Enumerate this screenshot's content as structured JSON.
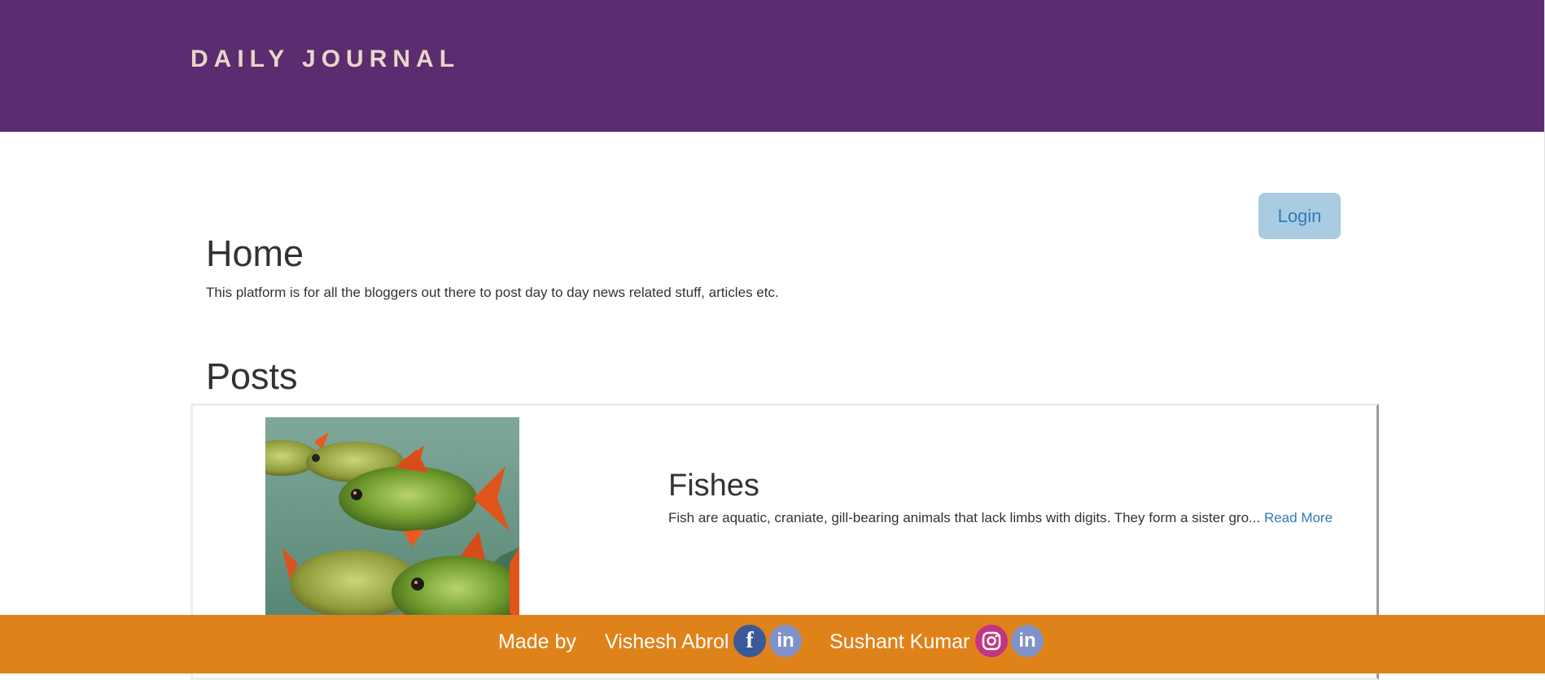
{
  "header": {
    "brand": "DAILY JOURNAL"
  },
  "auth": {
    "login_label": "Login"
  },
  "home": {
    "title": "Home",
    "description": "This platform is for all the bloggers out there to post day to day news related stuff, articles etc."
  },
  "posts": {
    "title": "Posts",
    "items": [
      {
        "title": "Fishes",
        "excerpt": "Fish are aquatic, craniate, gill-bearing animals that lack limbs with digits. They form a sister gro...",
        "read_more": "Read More",
        "image_icon": "fish-photo"
      }
    ]
  },
  "footer": {
    "made_by": "Made by",
    "authors": [
      {
        "name": "Vishesh Abrol",
        "icons": [
          "facebook-icon",
          "linkedin-icon"
        ]
      },
      {
        "name": "Sushant Kumar",
        "icons": [
          "instagram-icon",
          "linkedin-icon"
        ]
      }
    ]
  },
  "colors": {
    "header_bg": "#5b2c6f",
    "brand_text": "#e8d5c9",
    "login_bg": "#a9cce3",
    "link": "#337ab7",
    "footer_bg": "#e0821a",
    "facebook": "#3b5998",
    "linkedin": "#7f93c9",
    "instagram": "#c13584"
  }
}
